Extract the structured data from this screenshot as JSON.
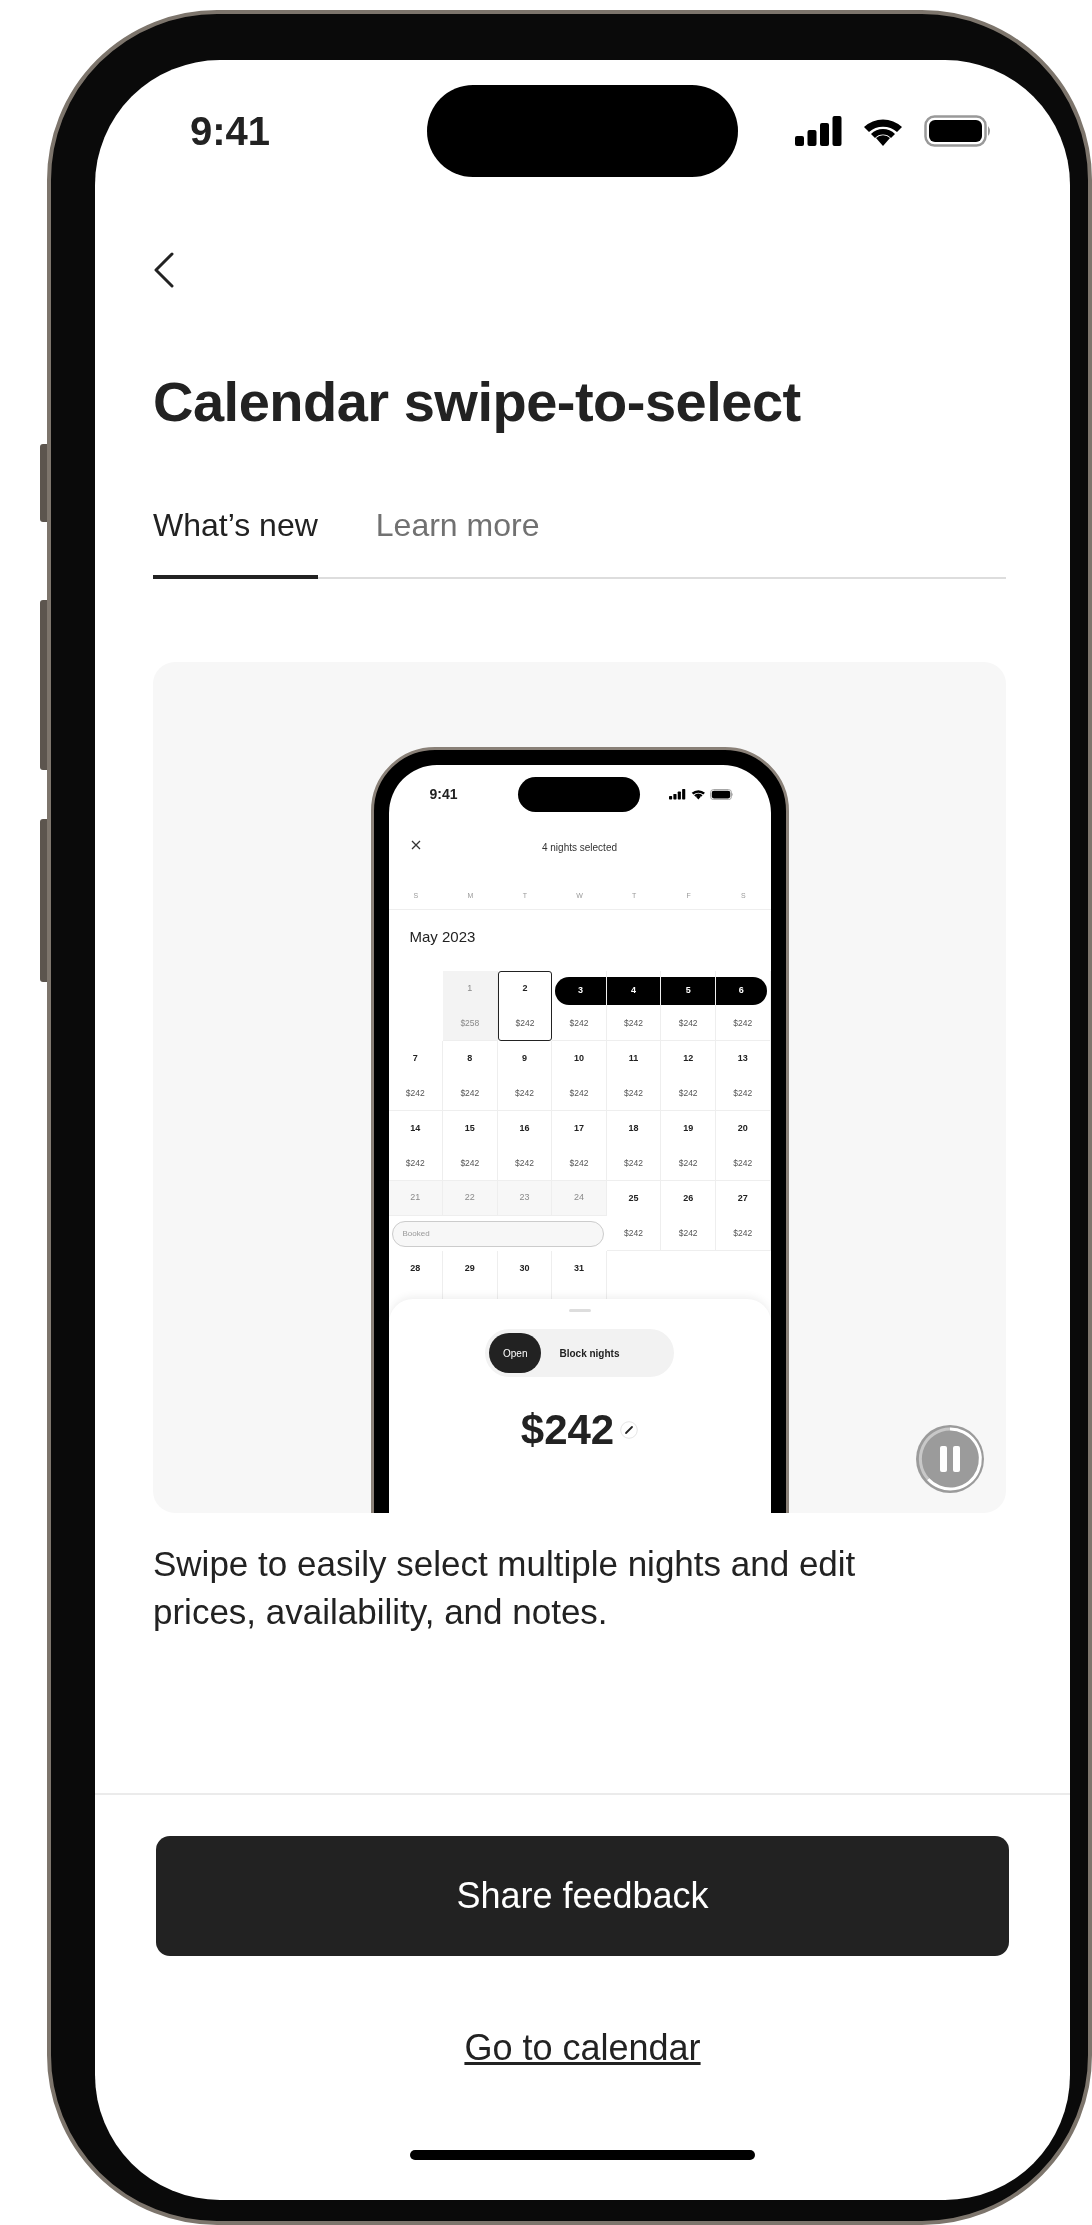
{
  "status_bar": {
    "time": "9:41"
  },
  "title": "Calendar swipe-to-select",
  "tabs": [
    {
      "label": "What’s new",
      "selected": true
    },
    {
      "label": "Learn more",
      "selected": false
    }
  ],
  "preview": {
    "status_bar": {
      "time": "9:41"
    },
    "header_title": "4 nights selected",
    "weekdays": [
      "S",
      "M",
      "T",
      "W",
      "T",
      "F",
      "S"
    ],
    "month": "May 2023",
    "weeks": [
      {
        "days": [
          {
            "kind": "blank"
          },
          {
            "kind": "past",
            "day": "1",
            "price": "$258"
          },
          {
            "kind": "outlined",
            "day": "2",
            "price": "$242"
          },
          {
            "kind": "selected",
            "day": "3",
            "price": "$242"
          },
          {
            "kind": "selected",
            "day": "4",
            "price": "$242"
          },
          {
            "kind": "selected",
            "day": "5",
            "price": "$242"
          },
          {
            "kind": "selected",
            "day": "6",
            "price": "$242"
          }
        ]
      },
      {
        "days": [
          {
            "kind": "open",
            "day": "7",
            "price": "$242"
          },
          {
            "kind": "open",
            "day": "8",
            "price": "$242"
          },
          {
            "kind": "open",
            "day": "9",
            "price": "$242"
          },
          {
            "kind": "open",
            "day": "10",
            "price": "$242"
          },
          {
            "kind": "open",
            "day": "11",
            "price": "$242"
          },
          {
            "kind": "open",
            "day": "12",
            "price": "$242"
          },
          {
            "kind": "open",
            "day": "13",
            "price": "$242"
          }
        ]
      },
      {
        "days": [
          {
            "kind": "open",
            "day": "14",
            "price": "$242"
          },
          {
            "kind": "open",
            "day": "15",
            "price": "$242"
          },
          {
            "kind": "open",
            "day": "16",
            "price": "$242"
          },
          {
            "kind": "open",
            "day": "17",
            "price": "$242"
          },
          {
            "kind": "open",
            "day": "18",
            "price": "$242"
          },
          {
            "kind": "open",
            "day": "19",
            "price": "$242"
          },
          {
            "kind": "open",
            "day": "20",
            "price": "$242"
          }
        ]
      },
      {
        "booked_label": "Booked",
        "days": [
          {
            "kind": "booked",
            "day": "21"
          },
          {
            "kind": "booked",
            "day": "22"
          },
          {
            "kind": "booked",
            "day": "23"
          },
          {
            "kind": "booked",
            "day": "24"
          },
          {
            "kind": "open",
            "day": "25",
            "price": "$242"
          },
          {
            "kind": "open",
            "day": "26",
            "price": "$242"
          },
          {
            "kind": "open",
            "day": "27",
            "price": "$242"
          }
        ]
      },
      {
        "days": [
          {
            "kind": "open",
            "day": "28"
          },
          {
            "kind": "open",
            "day": "29"
          },
          {
            "kind": "open",
            "day": "30"
          },
          {
            "kind": "open",
            "day": "31"
          }
        ]
      }
    ],
    "toggle": [
      {
        "label": "Open",
        "selected": true
      },
      {
        "label": "Block nights",
        "selected": false
      }
    ],
    "price": "$242"
  },
  "description": "Swipe to easily select multiple nights and edit prices, availability, and notes.",
  "primary_button": "Share feedback",
  "link": "Go to calendar"
}
